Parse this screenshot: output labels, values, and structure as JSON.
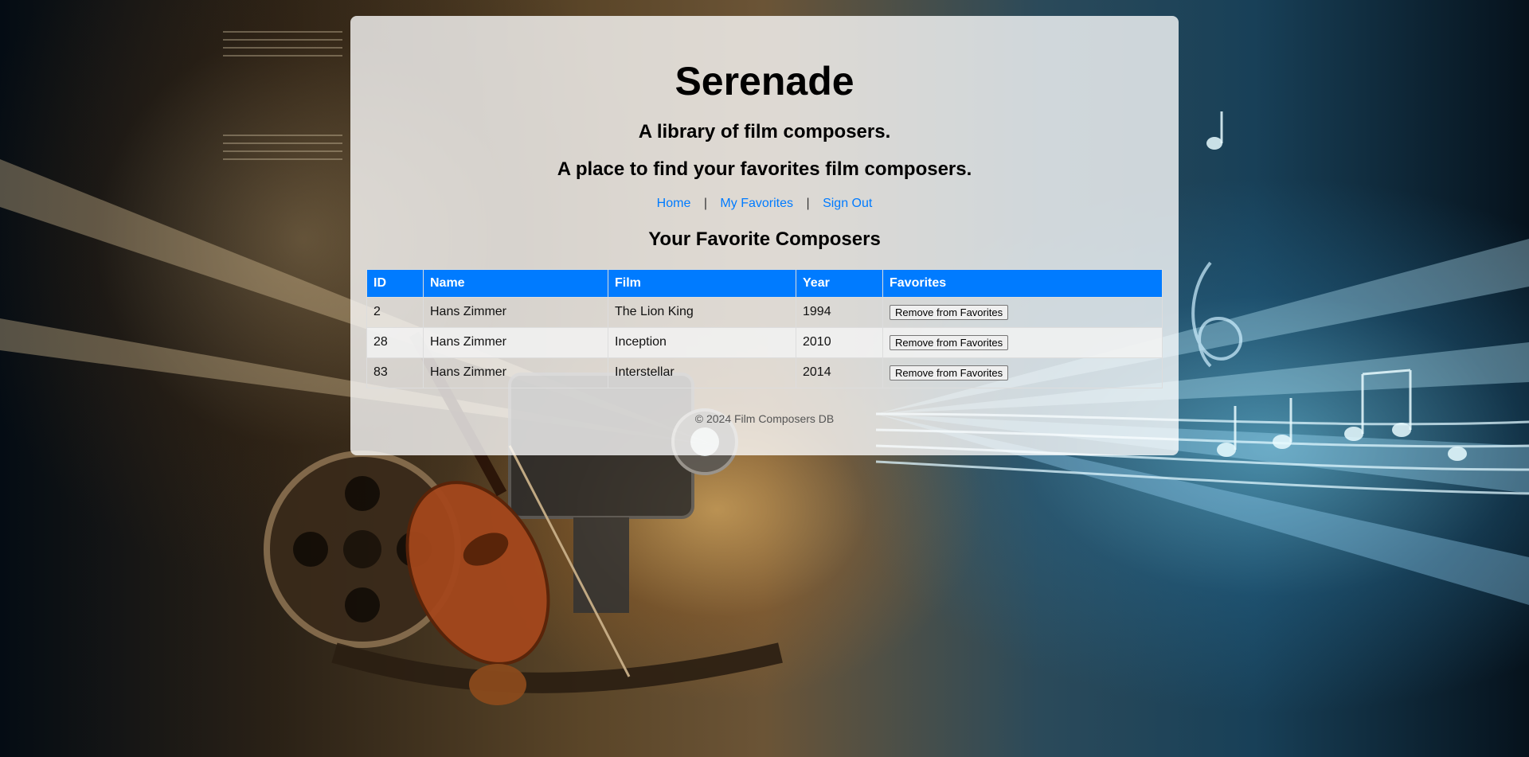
{
  "header": {
    "title": "Serenade",
    "tagline_1": "A library of film composers.",
    "tagline_2": "A place to find your favorites film composers."
  },
  "nav": {
    "home": "Home",
    "separator": "|",
    "my_favorites": "My Favorites",
    "sign_out": "Sign Out"
  },
  "main": {
    "section_title": "Your Favorite Composers",
    "table": {
      "columns": [
        "ID",
        "Name",
        "Film",
        "Year",
        "Favorites"
      ],
      "rows": [
        {
          "id": "2",
          "name": "Hans Zimmer",
          "film": "The Lion King",
          "year": "1994",
          "action": "Remove from Favorites"
        },
        {
          "id": "28",
          "name": "Hans Zimmer",
          "film": "Inception",
          "year": "2010",
          "action": "Remove from Favorites"
        },
        {
          "id": "83",
          "name": "Hans Zimmer",
          "film": "Interstellar",
          "year": "2014",
          "action": "Remove from Favorites"
        }
      ]
    }
  },
  "footer": {
    "text": "© 2024 Film Composers DB"
  },
  "colors": {
    "accent": "#007bff",
    "panel_background": "rgba(255,255,255,0.78)"
  },
  "background": {
    "icon": "film-music-collage-illustration"
  }
}
